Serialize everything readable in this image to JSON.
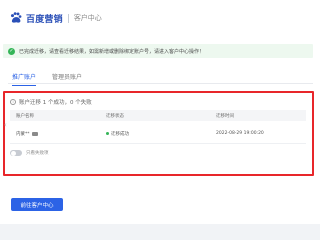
{
  "header": {
    "brand": "百度营销",
    "subtitle": "客户中心",
    "logo_icon": "baidu-paw-icon"
  },
  "notice": {
    "icon": "check-circle-icon",
    "text": "已完成迁移，请查看迁移结果，如需新增或删除绑定账户号，请进入客户中心操作！"
  },
  "tabs": [
    {
      "label": "推广账户",
      "active": true
    },
    {
      "label": "管理员账户",
      "active": false
    }
  ],
  "result": {
    "summary": "账户迁移 1 个成功，0 个失败",
    "columns": [
      "账户名称",
      "迁移状态",
      "迁移时间"
    ],
    "rows": [
      {
        "account": "内蒙**",
        "status": "迁移成功",
        "time": "2022-08-29 19:00:20"
      }
    ],
    "toggle_label": "只看失败项",
    "toggle_on": false
  },
  "footer": {
    "primary_button": "前往客户中心"
  },
  "colors": {
    "primary": "#2c63e6",
    "success": "#35b558",
    "highlight_border": "#e8262a"
  }
}
